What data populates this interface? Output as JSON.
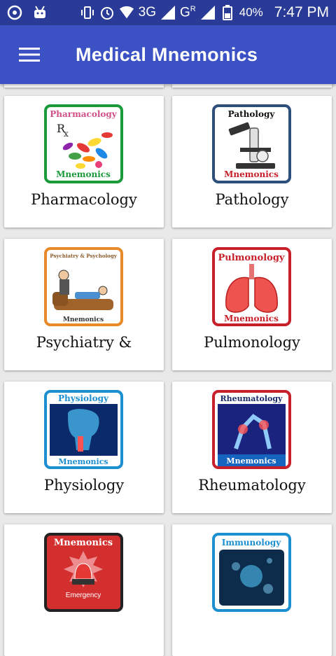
{
  "status": {
    "network": "3G",
    "network2": "G",
    "network2_sup": "R",
    "battery": "40%",
    "time": "7:47 PM"
  },
  "appbar": {
    "title": "Medical Mnemonics"
  },
  "cards": [
    {
      "label": "Pharmacology",
      "thumb_title": "Pharmacology",
      "thumb_footer": "Mnemonics",
      "frame": "#1a9a3a"
    },
    {
      "label": "Pathology",
      "thumb_title": "Pathology",
      "thumb_footer": "Mnemonics",
      "frame": "#2c4f7c"
    },
    {
      "label": "Psychiatry &",
      "thumb_title": "Psychiatry & Psychology",
      "thumb_footer": "Mnemonics",
      "frame": "#e88a2a"
    },
    {
      "label": "Pulmonology",
      "thumb_title": "Pulmonology",
      "thumb_footer": "Mnemonics",
      "frame": "#c8202a"
    },
    {
      "label": "Physiology",
      "thumb_title": "Physiology",
      "thumb_footer": "Mnemonics",
      "frame": "#1b8fd0"
    },
    {
      "label": "Rheumatology",
      "thumb_title": "Rheumatology",
      "thumb_footer": "Mnemonics",
      "frame": "#c8202a"
    },
    {
      "label": "",
      "thumb_title": "Mnemonics",
      "thumb_footer": "Emergency",
      "frame": "#222222"
    },
    {
      "label": "",
      "thumb_title": "Immunology",
      "thumb_footer": "",
      "frame": "#1b8fd0"
    }
  ]
}
